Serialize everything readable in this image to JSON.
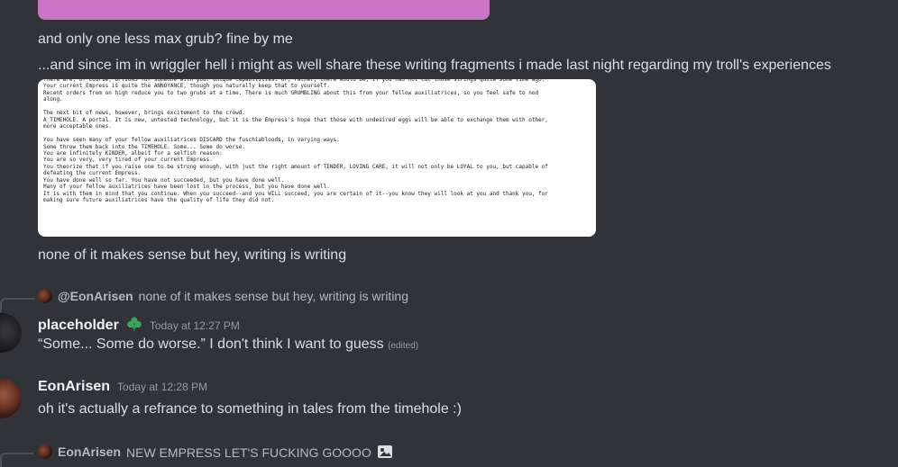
{
  "messages": {
    "line1": "and only one less max grub? fine by me",
    "line2": "...and since im in wriggler hell i might as well share these writing fragments i made last night regarding my troll's experiences",
    "attachment_text": "There are, of course, OPTIONS for someone with your unique capabilities. Or, rather, there would be, if you had not cut those strings quite some time ago.\nYour current Empress is quite the ANNOYANCE, though you naturally keep that to yourself.\nRecent orders from on high reduce you to two grubs at a time. There is much GRUMBLING about this from your fellow auxiliatrices, so you feel safe to nod\nalong.\n\nThe next bit of news, however, brings excitement to the crowd.\nA TIMEHOLE. A portal. It is new, untested technology, but it is the Empress's hope that those with undesired eggs will be able to exchange them with other,\nmore acceptable ones.\n\nYou have seen many of your fellow auxiliatrices DISCARD the fuschiabloods, in varying ways.\nSome throw them back into the TIMEHOLE. Some... Some do worse.\nYou are infinitely KINDER, albeit for a selfish reason:\nYou are so very, very tired of your current Empress.\nYou theorize that if you raise one to be strong enough, with just the right amount of TENDER, LOVING CARE, it will not only be LOYAL to you, but capable of\ndefeating the current Empress.\nYou have done well so far. You have not succeeded, but you have done well.\nMany of your fellow auxiliatrices have been lost in the process, but you have done well.\nIt is with them in mind that you continue. When you succeed--and you WILL succeed, you are certain of it--you know they will look at you and thank you, for\nmaking sure future auxiliatrices have the quality of life they did not.",
    "line3": "none of it makes sense but hey, writing is writing"
  },
  "reply1": {
    "name": "@EonArisen",
    "text": "none of it makes sense but hey, writing is writing"
  },
  "post1": {
    "username": "placeholder",
    "timestamp": "Today at 12:27 PM",
    "text": "“Some... Some do worse.” I don't think I want to guess",
    "edited": "(edited)",
    "role_icon": "green-clover-icon",
    "role_color": "#3ba55d"
  },
  "post2": {
    "username": "EonArisen",
    "timestamp": "Today at 12:28 PM",
    "text": "oh it's actually a refrance to something in tales from the timehole :)"
  },
  "reply2": {
    "name": "EonArisen",
    "text": "NEW EMPRESS LET'S FUCKING GOOOO",
    "icon": "image-icon"
  }
}
